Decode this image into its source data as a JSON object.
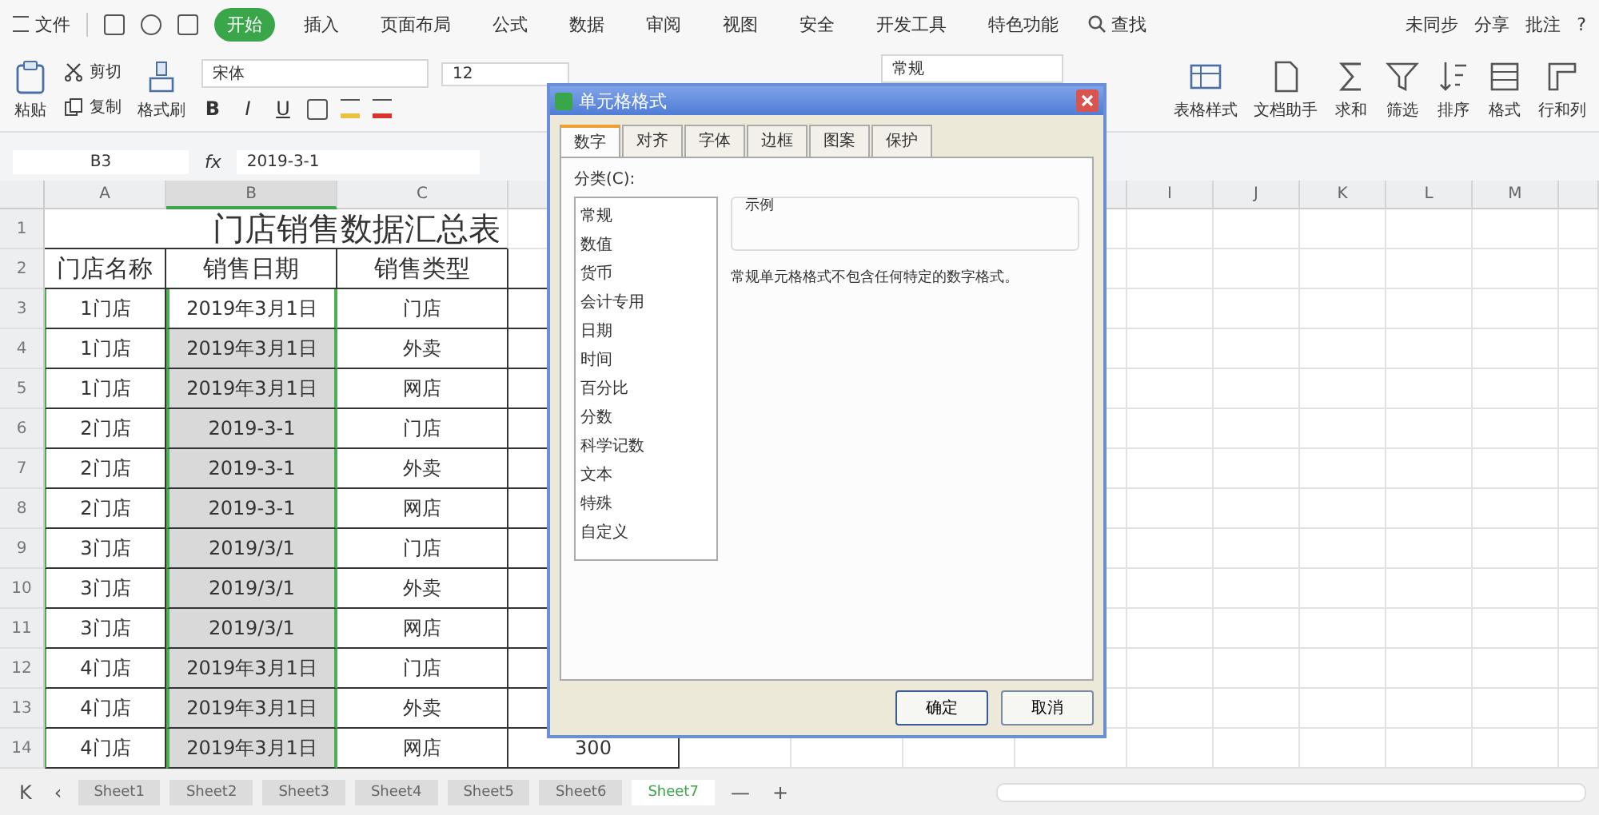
{
  "title_bar": {
    "menu": "文件",
    "tabs": [
      {
        "label": "开始",
        "selected": true
      },
      {
        "label": "插入",
        "selected": false
      },
      {
        "label": "页面布局",
        "selected": false
      },
      {
        "label": "公式",
        "selected": false
      },
      {
        "label": "数据",
        "selected": false
      },
      {
        "label": "审阅",
        "selected": false
      },
      {
        "label": "视图",
        "selected": false
      },
      {
        "label": "安全",
        "selected": false
      },
      {
        "label": "开发工具",
        "selected": false
      },
      {
        "label": "特色功能",
        "selected": false
      }
    ],
    "search": "查找",
    "actions": [
      "未同步",
      "分享",
      "批注"
    ],
    "help": "?"
  },
  "ribbon": {
    "clipboard": {
      "paste": "粘贴",
      "cut": "剪切",
      "copy": "复制",
      "painter": "格式刷"
    },
    "font": {
      "name": "宋体",
      "size": "12",
      "styles": [
        "B",
        "I",
        "U"
      ]
    },
    "number_format": "常规",
    "buttons": [
      "表格样式",
      "文档助手",
      "求和",
      "筛选",
      "排序",
      "格式",
      "行和列"
    ]
  },
  "formula_bar": {
    "name_box": "B3",
    "fx": "fx",
    "value": "2019-3-1"
  },
  "sheet": {
    "columns": [
      "A",
      "B",
      "C",
      "",
      "",
      "",
      "",
      "",
      "I",
      "J",
      "K",
      "L",
      "M"
    ],
    "title_row": "1",
    "title": "门店销售数据汇总表",
    "header_row": "2",
    "headers": [
      "门店名称",
      "销售日期",
      "销售类型"
    ],
    "rows": [
      {
        "row": "3",
        "cells": [
          "1门店",
          "2019年3月1日",
          "门店",
          ""
        ]
      },
      {
        "row": "4",
        "cells": [
          "1门店",
          "2019年3月1日",
          "外卖",
          ""
        ]
      },
      {
        "row": "5",
        "cells": [
          "1门店",
          "2019年3月1日",
          "网店",
          ""
        ]
      },
      {
        "row": "6",
        "cells": [
          "2门店",
          "2019-3-1",
          "门店",
          ""
        ]
      },
      {
        "row": "7",
        "cells": [
          "2门店",
          "2019-3-1",
          "外卖",
          ""
        ]
      },
      {
        "row": "8",
        "cells": [
          "2门店",
          "2019-3-1",
          "网店",
          ""
        ]
      },
      {
        "row": "9",
        "cells": [
          "3门店",
          "2019/3/1",
          "门店",
          ""
        ]
      },
      {
        "row": "10",
        "cells": [
          "3门店",
          "2019/3/1",
          "外卖",
          ""
        ]
      },
      {
        "row": "11",
        "cells": [
          "3门店",
          "2019/3/1",
          "网店",
          ""
        ]
      },
      {
        "row": "12",
        "cells": [
          "4门店",
          "2019年3月1日",
          "门店",
          ""
        ]
      },
      {
        "row": "13",
        "cells": [
          "4门店",
          "2019年3月1日",
          "外卖",
          ""
        ]
      },
      {
        "row": "14",
        "cells": [
          "4门店",
          "2019年3月1日",
          "网店",
          "300"
        ]
      }
    ]
  },
  "sheet_nav": [
    "K",
    "‹"
  ],
  "sheet_actions": [
    "—",
    "+"
  ],
  "sheet_tabs": [
    {
      "label": "Sheet1",
      "selected": false
    },
    {
      "label": "Sheet2",
      "selected": false
    },
    {
      "label": "Sheet3",
      "selected": false
    },
    {
      "label": "Sheet4",
      "selected": false
    },
    {
      "label": "Sheet5",
      "selected": false
    },
    {
      "label": "Sheet6",
      "selected": false
    },
    {
      "label": "Sheet7",
      "selected": true
    }
  ],
  "dialog": {
    "title": "单元格格式",
    "tabs": [
      {
        "label": "数字",
        "selected": true
      },
      {
        "label": "对齐",
        "selected": false
      },
      {
        "label": "字体",
        "selected": false
      },
      {
        "label": "边框",
        "selected": false
      },
      {
        "label": "图案",
        "selected": false
      },
      {
        "label": "保护",
        "selected": false
      }
    ],
    "category_label": "分类(C):",
    "categories": [
      {
        "label": "常规",
        "selected": false
      },
      {
        "label": "数值",
        "selected": false
      },
      {
        "label": "货币",
        "selected": false
      },
      {
        "label": "会计专用",
        "selected": false
      },
      {
        "label": "日期",
        "selected": false
      },
      {
        "label": "时间",
        "selected": false
      },
      {
        "label": "百分比",
        "selected": false
      },
      {
        "label": "分数",
        "selected": false
      },
      {
        "label": "科学记数",
        "selected": false
      },
      {
        "label": "文本",
        "selected": false
      },
      {
        "label": "特殊",
        "selected": false
      },
      {
        "label": "自定义",
        "selected": false
      }
    ],
    "sample_label": "示例",
    "description": "常规单元格格式不包含任何特定的数字格式。",
    "buttons": [
      "确定",
      "取消"
    ]
  }
}
